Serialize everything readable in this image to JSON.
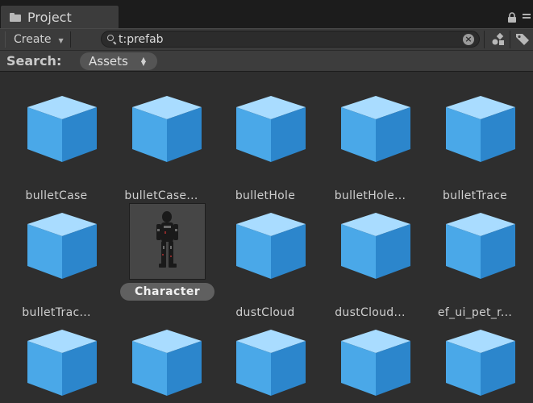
{
  "window": {
    "tab_title": "Project",
    "tab_icon": "folder-icon"
  },
  "toolbar": {
    "create_label": "Create",
    "search_value": "t:prefab",
    "type_filter_icon": "type-filter-icon",
    "label_filter_icon": "label-filter-icon"
  },
  "scope": {
    "label": "Search:",
    "selected": "Assets"
  },
  "assets": [
    {
      "name": "bulletCase",
      "icon": "prefab-cube-icon"
    },
    {
      "name": "bulletCase...",
      "icon": "prefab-cube-icon"
    },
    {
      "name": "bulletHole",
      "icon": "prefab-cube-icon"
    },
    {
      "name": "bulletHole...",
      "icon": "prefab-cube-icon"
    },
    {
      "name": "bulletTrace",
      "icon": "prefab-cube-icon"
    },
    {
      "name": "bulletTrac...",
      "icon": "prefab-cube-icon"
    },
    {
      "name": "Character",
      "icon": "character-model-thumbnail",
      "selected": true
    },
    {
      "name": "dustCloud",
      "icon": "prefab-cube-icon"
    },
    {
      "name": "dustCloud...",
      "icon": "prefab-cube-icon"
    },
    {
      "name": "ef_ui_pet_r...",
      "icon": "prefab-cube-icon"
    },
    {
      "name": "",
      "icon": "prefab-cube-icon"
    },
    {
      "name": "",
      "icon": "prefab-cube-icon"
    },
    {
      "name": "",
      "icon": "prefab-cube-icon"
    },
    {
      "name": "",
      "icon": "prefab-cube-icon"
    },
    {
      "name": "",
      "icon": "prefab-cube-icon"
    }
  ],
  "colors": {
    "background": "#2e2e2e",
    "cube_top": "#a9dcff",
    "cube_left": "#4aa8e8",
    "cube_right": "#2c86cc",
    "selected_pill": "#606060"
  }
}
